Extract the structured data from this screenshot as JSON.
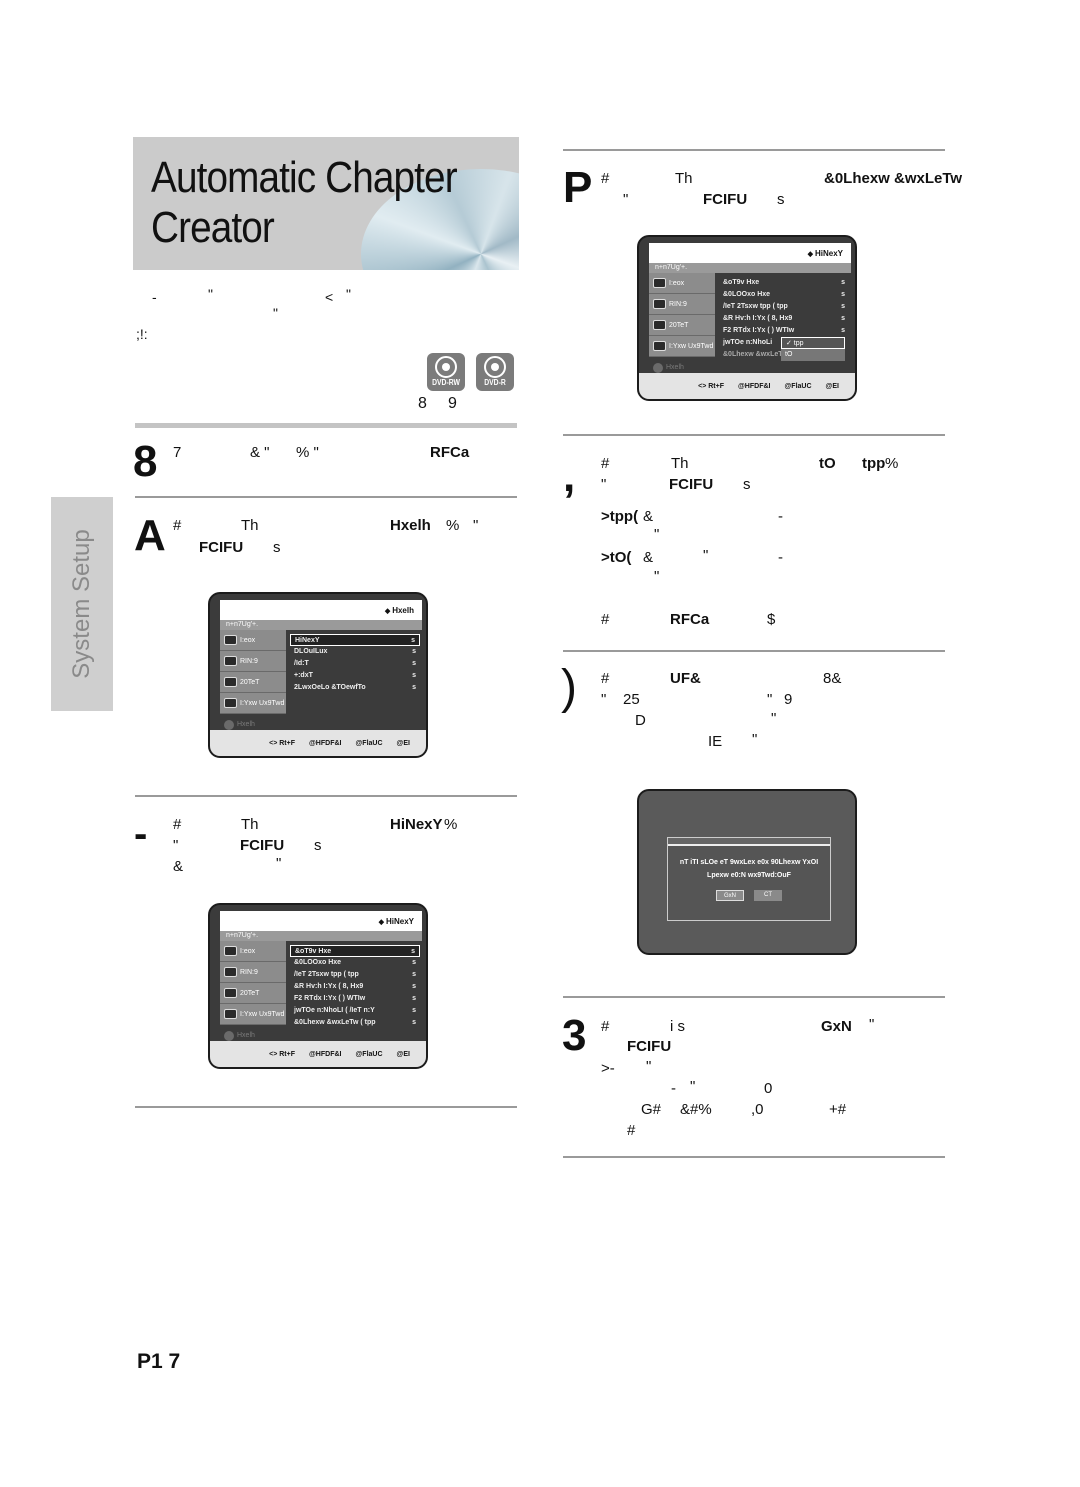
{
  "title": {
    "line1": "Automatic Chapter",
    "line2": "Creator"
  },
  "intro": {
    "line1a": "-",
    "line1b": "\"",
    "line1c": "<",
    "line1d": "\"",
    "line2": "\"",
    "line3": ";!:"
  },
  "discs": {
    "badges": [
      {
        "label": "DVD-RW"
      },
      {
        "label": "DVD-R"
      }
    ],
    "nums": [
      "8",
      "9"
    ]
  },
  "side_tab": "System Setup",
  "page_number": "P1 7",
  "steps": [
    {
      "num": "8",
      "parts": [
        "7",
        "& \"",
        "% \"",
        "RFCa"
      ]
    },
    {
      "num": "A",
      "parts": [
        "#",
        "Th",
        "Hxelh",
        "%",
        "\"",
        "FCIFU",
        "s"
      ]
    },
    {
      "num": "-",
      "parts": [
        "#",
        "Th",
        "HiNexY",
        "%",
        "\"",
        "FCIFU",
        "s",
        "&",
        "\""
      ]
    },
    {
      "num": "P",
      "parts": [
        "#",
        "Th",
        "&0Lhexw &wxLeTw",
        "%",
        "\"",
        "FCIFU",
        "s"
      ]
    },
    {
      "num": ",",
      "parts": [
        "#",
        "Th",
        "tO",
        "tpp",
        "%",
        "\"",
        "FCIFU",
        "s"
      ],
      "bullets": [
        {
          "key": ">tpp(",
          "text": "&",
          "dash": "-",
          "q": "\""
        },
        {
          "key": ">tO(",
          "text": "&",
          "q1": "\"",
          "dash": "-",
          "q": "\""
        }
      ],
      "footer": {
        "a": "#",
        "b": "RFCa",
        "c": "$"
      }
    },
    {
      "num": ")",
      "lines": [
        {
          "a": "#",
          "b": "UF&",
          "c": "8&"
        },
        {
          "a": "\"",
          "b": "25",
          "c": "\"",
          "d": "9"
        },
        {
          "a": "D",
          "b": "\""
        },
        {
          "a": "IE",
          "b": "\""
        }
      ]
    },
    {
      "num": "3",
      "parts": [
        "#",
        "i s",
        "GxN",
        "\"",
        "FCIFU"
      ],
      "lines": [
        {
          "a": ">-",
          "b": "\""
        },
        {
          "a": "-",
          "b": "\"",
          "c": "0"
        },
        {
          "a": "G#",
          "b": "&#%",
          "c": ",0",
          "d": "+#"
        },
        {
          "a": "#"
        }
      ]
    }
  ],
  "osd": {
    "subheader": "n+n7Ug'+.",
    "menu": [
      "I:eox",
      "RIN:9",
      "20TeT",
      "I:Yxw Ux9Twd",
      "Hxelh"
    ],
    "bottom": [
      "<> Rt+F",
      "@HFDF&I",
      "@FlaUC",
      "@EI"
    ],
    "screen1": {
      "mode": "Hxelh",
      "rows": [
        "HiNexY",
        "DLOuILux",
        "/Id:T",
        "+:dxT",
        "2LwxOeLo &TOewfTo"
      ],
      "selected": 0
    },
    "screen2": {
      "mode": "HiNexY",
      "rows": [
        "&oT9v Hxe",
        "&0LOOxo Hxe",
        "/IeT 2Tsxw tpp   ( tpp",
        "&R Hv:h I:Yx     ( 8, Hx9",
        "F2 RTdx I:Yx    ( ) WTIw",
        "jwTOe n:NhoLI    ( /IeT n:Y",
        "&0Lhexw &wxLeTw  ( tpp"
      ],
      "selected": 0
    },
    "screen3": {
      "mode": "HiNexY",
      "rows": [
        "&oT9v Hxe",
        "&0LOOxo Hxe",
        "/IeT 2Tsxw tpp   ( tpp",
        "&R Hv:h I:Yx     ( 8, Hx9",
        "F2 RTdx I:Yx    ( ) WTIw",
        "jwTOe n:NhoLi",
        "&0Lhexw &wxLeT"
      ],
      "popup": [
        "✓ tpp",
        "tO"
      ],
      "popup_selected": 0
    },
    "dialog": {
      "line1": "nT iTI sLOe eT 9wxLex e0x 90Lhexw YxOI",
      "line2": "Lpexw e0:N wx9Twd:OuF",
      "ok": "GxN",
      "cancel": "CT"
    }
  },
  "colors": {
    "title_bg": "#cbcbcb",
    "osd_bg": "#3b3b3b",
    "side_tab_bg": "#cfcfcf",
    "rule": "#9a9a9a"
  }
}
